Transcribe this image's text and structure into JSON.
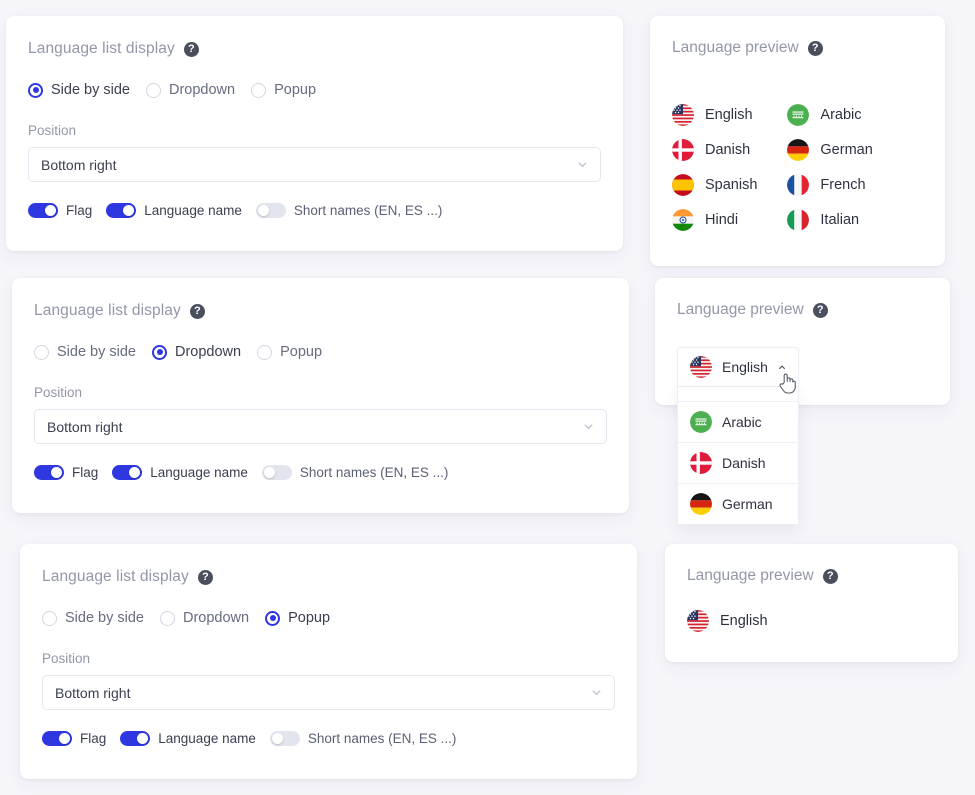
{
  "theme": {
    "page_background": "#f5f5fa",
    "card_background": "#ffffff",
    "accent": "#2f37e0",
    "muted_text": "#9397a8",
    "body_text": "#3b3f50",
    "switch_off": "#e2e4ee"
  },
  "labels": {
    "settings_title": "Language list display",
    "preview_title": "Language preview",
    "position_label": "Position",
    "help_icon_glyph": "?",
    "help_icon_name": "question-mark-icon",
    "chevron_down_icon": "chevron-down-icon",
    "chevron_up_icon": "chevron-up-icon",
    "cursor_icon": "pointing-hand-cursor"
  },
  "display_options": [
    {
      "id": "side-by-side",
      "label": "Side by side"
    },
    {
      "id": "dropdown",
      "label": "Dropdown"
    },
    {
      "id": "popup",
      "label": "Popup"
    }
  ],
  "position_select": {
    "value": "Bottom right",
    "placeholder": "Bottom right"
  },
  "toggles": [
    {
      "id": "flag",
      "label": "Flag",
      "on": true
    },
    {
      "id": "language-name",
      "label": "Language name",
      "on": true
    },
    {
      "id": "short-names",
      "label": "Short names (EN, ES ...)",
      "on": false
    }
  ],
  "languages": {
    "english": "English",
    "arabic": "Arabic",
    "danish": "Danish",
    "german": "German",
    "spanish": "Spanish",
    "french": "French",
    "hindi": "Hindi",
    "italian": "Italian"
  },
  "panels": [
    {
      "id": "side-by-side",
      "selected_option": "Side by side",
      "preview_mode": "side-by-side",
      "preview_columns": [
        [
          "English",
          "Danish",
          "Spanish",
          "Hindi"
        ],
        [
          "Arabic",
          "German",
          "French",
          "Italian"
        ]
      ]
    },
    {
      "id": "dropdown",
      "selected_option": "Dropdown",
      "preview_mode": "dropdown",
      "dropdown_selected": "English",
      "dropdown_open": true,
      "dropdown_options": [
        "Arabic",
        "Danish",
        "German"
      ]
    },
    {
      "id": "popup",
      "selected_option": "Popup",
      "preview_mode": "popup",
      "popup_items": [
        "English"
      ]
    }
  ]
}
